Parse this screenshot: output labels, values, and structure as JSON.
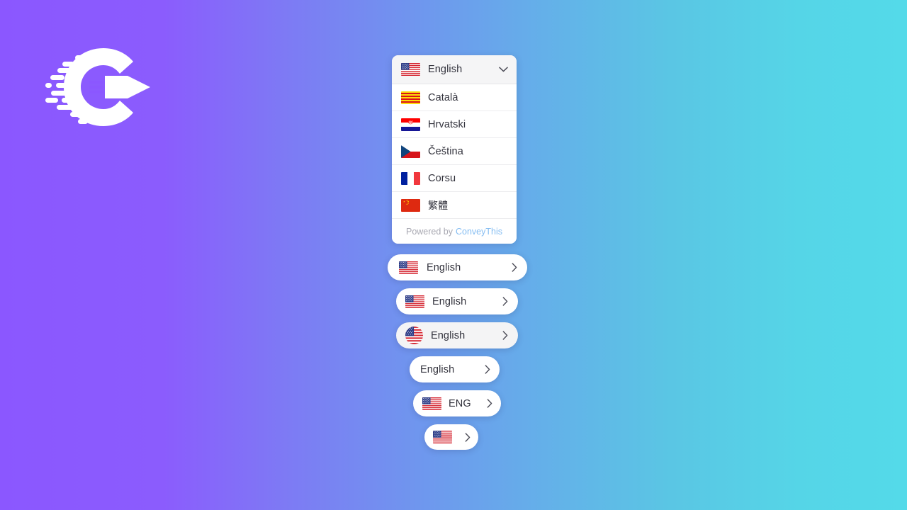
{
  "brand": {
    "logo_name": "conveythis-rocket-logo",
    "name": "ConveyThis"
  },
  "background": {
    "gradient_from": "#8b57ff",
    "gradient_to": "#54dae9",
    "direction": "horizontal"
  },
  "dropdown": {
    "selected": {
      "label": "English",
      "flag": "us-flag-icon"
    },
    "chevron": "chevron-down-icon",
    "items": [
      {
        "label": "Català",
        "flag": "catalonia-flag-icon"
      },
      {
        "label": "Hrvatski",
        "flag": "croatia-flag-icon"
      },
      {
        "label": "Čeština",
        "flag": "czech-flag-icon"
      },
      {
        "label": "Corsu",
        "flag": "france-flag-icon"
      },
      {
        "label": "繁體",
        "flag": "china-flag-icon"
      }
    ],
    "footer": {
      "powered_by": "Powered by",
      "brand": "ConveyThis",
      "brand_color": "#85bdf2"
    }
  },
  "buttons": [
    {
      "name": "language-switcher-pill-wide",
      "label": "English",
      "flag": "us-flag-icon",
      "flag_shape": "rect",
      "chevron": "chevron-right-icon",
      "background": "#ffffff"
    },
    {
      "name": "language-switcher-pill-medium",
      "label": "English",
      "flag": "us-flag-icon",
      "flag_shape": "rect",
      "chevron": "chevron-right-icon",
      "background": "#ffffff"
    },
    {
      "name": "language-switcher-pill-circle-flag",
      "label": "English",
      "flag": "us-flag-icon",
      "flag_shape": "circle",
      "chevron": "chevron-right-icon",
      "background": "#f4f4f5"
    },
    {
      "name": "language-switcher-pill-text-only",
      "label": "English",
      "flag": null,
      "flag_shape": null,
      "chevron": "chevron-right-icon",
      "background": "#ffffff"
    },
    {
      "name": "language-switcher-pill-code",
      "label": "ENG",
      "flag": "us-flag-icon",
      "flag_shape": "rect",
      "chevron": "chevron-right-icon",
      "background": "#ffffff"
    },
    {
      "name": "language-switcher-pill-flag-only",
      "label": "",
      "flag": "us-flag-icon",
      "flag_shape": "rect",
      "chevron": "chevron-right-icon",
      "background": "#ffffff"
    }
  ]
}
